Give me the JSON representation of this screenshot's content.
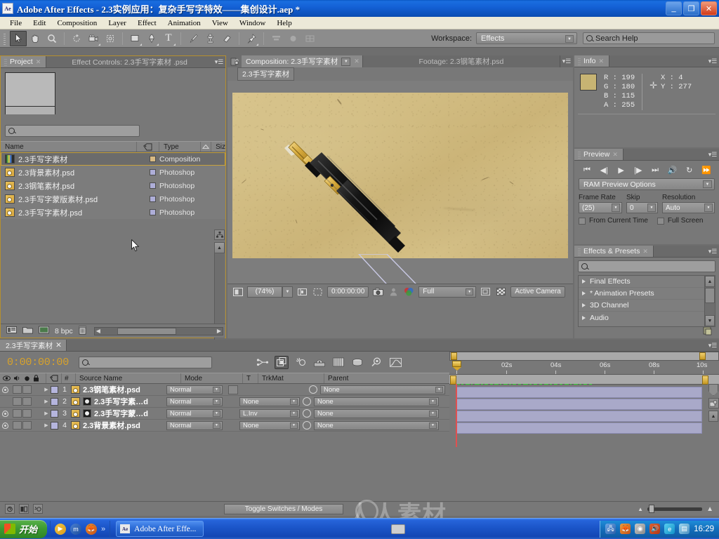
{
  "window": {
    "app_icon": "Ae",
    "title": "Adobe After Effects - 2.3实例应用：复杂手写字特效——集创设计.aep  *",
    "minimize": "_",
    "maximize": "❐",
    "close": "✕"
  },
  "menubar": {
    "items": [
      "File",
      "Edit",
      "Composition",
      "Layer",
      "Effect",
      "Animation",
      "View",
      "Window",
      "Help"
    ]
  },
  "toolbar": {
    "tools": [
      {
        "name": "selection-tool",
        "glyph": "➤",
        "active": true
      },
      {
        "name": "hand-tool",
        "glyph": "✋",
        "active": false
      },
      {
        "name": "zoom-tool",
        "glyph": "🔍",
        "active": false
      },
      {
        "name": "rotation-tool",
        "glyph": "↻",
        "active": false
      },
      {
        "name": "camera-tool",
        "glyph": "🎥",
        "active": false
      },
      {
        "name": "pan-behind-tool",
        "glyph": "✥",
        "active": false
      },
      {
        "name": "shape-tool",
        "glyph": "▢",
        "active": false
      },
      {
        "name": "pen-tool",
        "glyph": "✎",
        "active": false
      },
      {
        "name": "type-tool",
        "glyph": "T",
        "active": false
      },
      {
        "name": "brush-tool",
        "glyph": "🖌",
        "active": false
      },
      {
        "name": "clone-stamp-tool",
        "glyph": "⚘",
        "active": false
      },
      {
        "name": "eraser-tool",
        "glyph": "▱",
        "active": false
      },
      {
        "name": "puppet-pin-tool",
        "glyph": "📌",
        "active": false
      }
    ],
    "workspace_label": "Workspace:",
    "workspace_value": "Effects",
    "search_help_placeholder": "Search Help"
  },
  "project_panel": {
    "tab_label": "Project",
    "secondary_tab": "Effect Controls: 2.3手写字素材 .psd",
    "search_value": "",
    "columns": [
      "Name",
      "Type",
      "Siz"
    ],
    "items": [
      {
        "name": "2.3手写字素材",
        "type": "Composition",
        "kind": "comp",
        "selected": true
      },
      {
        "name": "2.3背景素材.psd",
        "type": "Photoshop",
        "kind": "psd",
        "selected": false
      },
      {
        "name": "2.3钢笔素材.psd",
        "type": "Photoshop",
        "kind": "psd",
        "selected": false
      },
      {
        "name": "2.3手写字蒙版素材.psd",
        "type": "Photoshop",
        "kind": "psd",
        "selected": false
      },
      {
        "name": "2.3手写字素材.psd",
        "type": "Photoshop",
        "kind": "psd",
        "selected": false
      }
    ],
    "footer_bpc": "8 bpc"
  },
  "comp_panel": {
    "tab_active": "Composition: 2.3手写字素材",
    "tab_inactive": "Footage: 2.3钢笔素材.psd",
    "breadcrumb": "2.3手写字素材",
    "zoom": "(74%)",
    "time": "0:00:00:00",
    "resolution": "Full",
    "view": "Active Camera",
    "canvas_description": "fountain pen on aged parchment paper"
  },
  "info_panel": {
    "tab_label": "Info",
    "swatch_color": "#c7b473",
    "r_label": "R :",
    "r_value": "199",
    "g_label": "G :",
    "g_value": "180",
    "b_label": "B :",
    "b_value": "115",
    "a_label": "A :",
    "a_value": "255",
    "x_label": "X :",
    "x_value": "4",
    "y_label": "Y :",
    "y_value": "277"
  },
  "preview_panel": {
    "tab_label": "Preview",
    "buttons": [
      "⏮",
      "◀|",
      "▶",
      "|▶",
      "⏭",
      "🔊",
      "↻",
      "⏩"
    ],
    "ram_preview_options": "RAM Preview Options",
    "frame_rate_label": "Frame Rate",
    "frame_rate_value": "(25)",
    "skip_label": "Skip",
    "skip_value": "0",
    "resolution_label": "Resolution",
    "resolution_value": "Auto",
    "from_current_time": "From Current Time",
    "full_screen": "Full Screen"
  },
  "effects_panel": {
    "tab_label": "Effects & Presets",
    "search_value": "",
    "items": [
      "Final Effects",
      "* Animation Presets",
      "3D Channel",
      "Audio"
    ]
  },
  "timeline": {
    "tab_label": "2.3手写字素材",
    "current_time": "0:00:00:00",
    "search_value": "",
    "columns": [
      "Source Name",
      "Mode",
      "T",
      "TrkMat",
      "Parent"
    ],
    "hash_label": "#",
    "layers": [
      {
        "num": "1",
        "name": "2.3钢笔素材.psd",
        "mode": "Normal",
        "trkmat": "",
        "parent": "None",
        "visible": true,
        "has_mask": false,
        "has_trkmat": false
      },
      {
        "num": "2",
        "name": "2.3手写字素…d",
        "mode": "Normal",
        "trkmat": "None",
        "parent": "None",
        "visible": false,
        "has_mask": true,
        "has_trkmat": true
      },
      {
        "num": "3",
        "name": "2.3手写字蒙…d",
        "mode": "Normal",
        "trkmat": "L.Inv",
        "parent": "None",
        "visible": true,
        "has_mask": true,
        "has_trkmat": true
      },
      {
        "num": "4",
        "name": "2.3背景素材.psd",
        "mode": "Normal",
        "trkmat": "None",
        "parent": "None",
        "visible": true,
        "has_mask": false,
        "has_trkmat": true
      }
    ],
    "ruler_ticks": [
      "0s",
      "02s",
      "04s",
      "06s",
      "08s",
      "10s"
    ],
    "toggle_switches_modes": "Toggle Switches / Modes"
  },
  "watermark": {
    "text": "人人素材"
  },
  "taskbar": {
    "start_label": "开始",
    "task_app_icon": "Ae",
    "task_app_label": "Adobe After Effe...",
    "clock": "16:29"
  }
}
